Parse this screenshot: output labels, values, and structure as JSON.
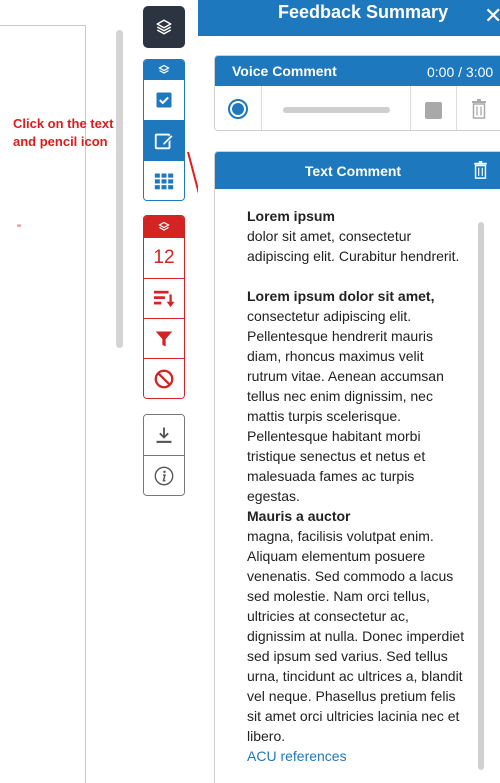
{
  "annotation": {
    "text": "Click on the text and pencil icon"
  },
  "toolbar": {
    "red_group": {
      "count_value": "12"
    }
  },
  "panel": {
    "title": "Feedback Summary",
    "close": "✕"
  },
  "voice_comment": {
    "title": "Voice Comment",
    "time": "0:00 / 3:00",
    "progress": 0
  },
  "text_comment": {
    "title": "Text Comment",
    "heading1": "Lorem ipsum",
    "para1": "dolor sit amet, consectetur adipiscing elit. Curabitur hendrerit.",
    "heading2": "Lorem ipsum dolor sit amet,",
    "para2": "consectetur adipiscing elit. Pellentesque hendrerit mauris diam, rhoncus maximus velit rutrum vitae. Aenean accumsan tellus nec enim dignissim, nec mattis turpis scelerisque. Pellentesque habitant morbi tristique senectus et netus et malesuada fames ac turpis egestas.",
    "heading3": "Mauris a auctor",
    "para3": "magna, facilisis volutpat enim. Aliquam elementum posuere venenatis. Sed commodo a lacus sed molestie. Nam orci tellus, ultricies at consectetur ac, dignissim at nulla. Donec imperdiet sed ipsum sed varius. Sed tellus urna, tincidunt ac ultrices a, blandit vel neque. Phasellus pretium felis sit amet orci ultricies lacinia nec et libero.",
    "link": "ACU references"
  },
  "colors": {
    "primary": "#1e78be",
    "danger": "#d32323",
    "dark": "#2b3440",
    "annotation": "#e01b1b"
  }
}
